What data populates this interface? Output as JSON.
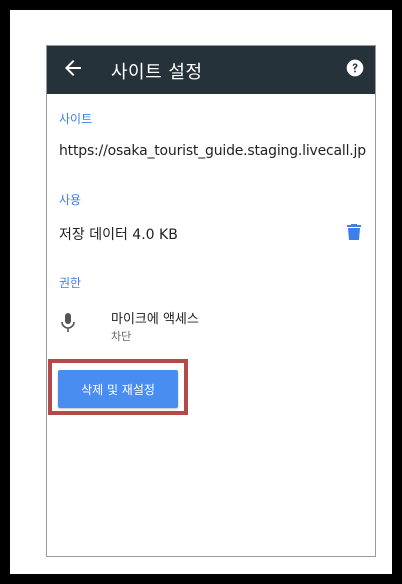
{
  "appbar": {
    "title": "사이트 설정"
  },
  "site": {
    "section_label": "사이트",
    "url": "https://osaka_tourist_guide.staging.livecall.jp"
  },
  "usage": {
    "section_label": "사용",
    "stored_data": "저장 데이터 4.0 KB"
  },
  "permissions": {
    "section_label": "권한",
    "items": [
      {
        "icon": "microphone-icon",
        "title": "마이크에 액세스",
        "status": "차단"
      }
    ]
  },
  "actions": {
    "clear_reset_label": "삭제 및 재설정"
  },
  "colors": {
    "appbar_bg": "#26323a",
    "accent": "#3f7ee8",
    "button_bg": "#4a8df0",
    "highlight_border": "#b24a4a"
  }
}
